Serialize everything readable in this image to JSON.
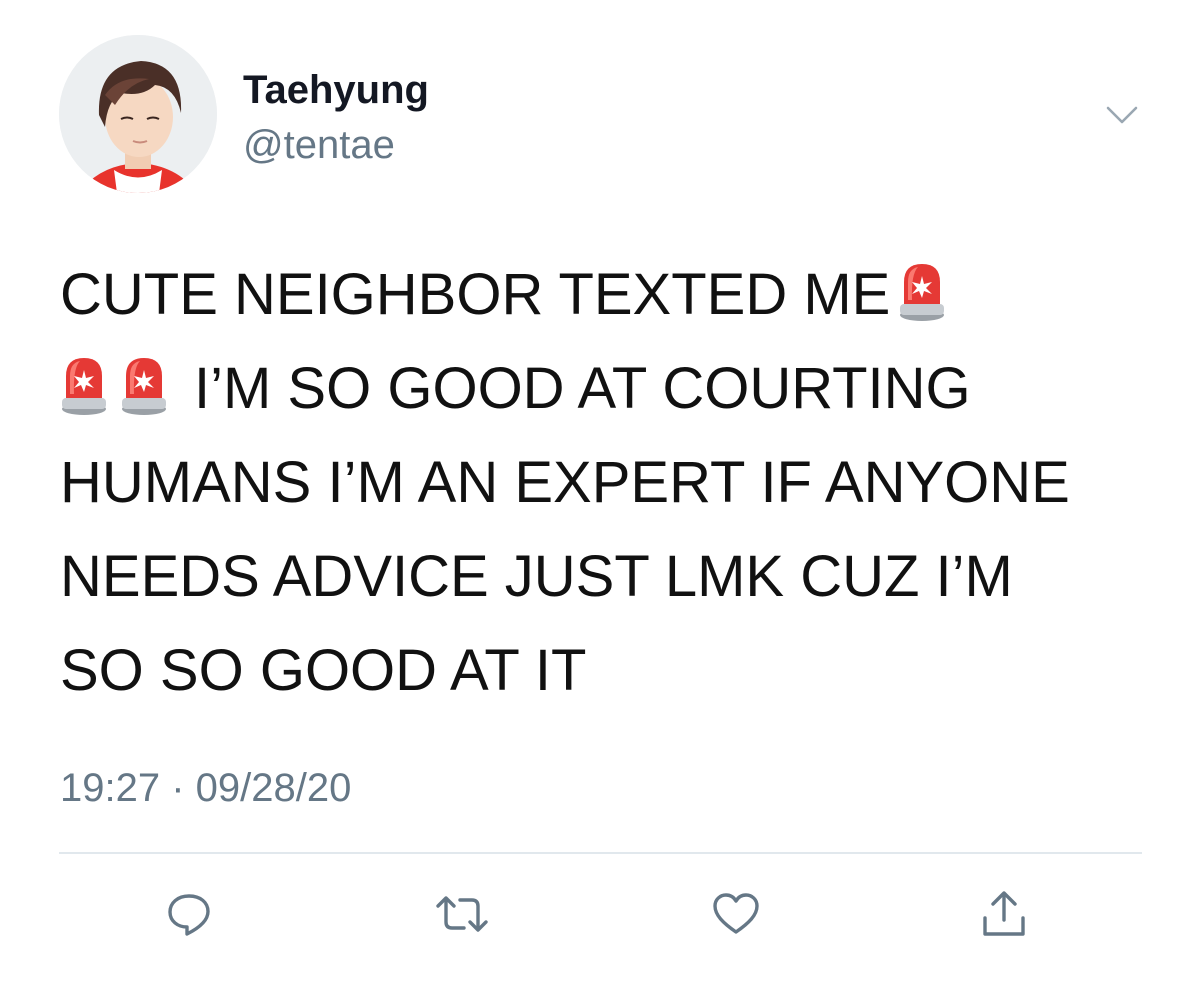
{
  "user": {
    "display_name": "Taehyung",
    "handle": "@tentae"
  },
  "tweet": {
    "line_1": "CUTE NEIGHBOR TEXTED ME",
    "line_2": "I’M SO GOOD AT COURTING",
    "line_3": "HUMANS I’M AN EXPERT IF ANYONE",
    "line_4": "NEEDS ADVICE JUST LMK CUZ I’M",
    "line_5": "SO SO GOOD AT IT",
    "emoji": "police-car-light-emoji"
  },
  "meta": {
    "timestamp": "19:27 · 09/28/20"
  },
  "actions": {
    "icons": [
      "reply-icon",
      "retweet-icon",
      "like-icon",
      "share-icon"
    ]
  },
  "colors": {
    "secondary_text": "#657786",
    "divider": "#e1e8ed",
    "icon": "#657786"
  }
}
